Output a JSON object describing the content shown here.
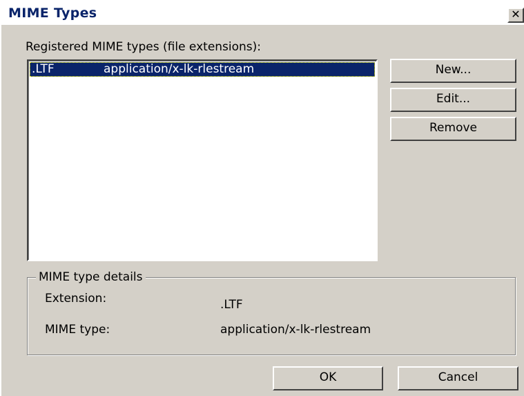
{
  "window": {
    "title": "MIME Types",
    "close_glyph": "✕"
  },
  "list": {
    "label": "Registered MIME types (file extensions):",
    "items": [
      {
        "extension": ".LTF",
        "mime": "application/x-lk-rlestream",
        "selected": true
      }
    ]
  },
  "buttons": {
    "new": "New...",
    "edit": "Edit...",
    "remove": "Remove",
    "ok": "OK",
    "cancel": "Cancel"
  },
  "details": {
    "group_title": "MIME type details",
    "extension_label": "Extension:",
    "extension_value": ".LTF",
    "mime_label": "MIME type:",
    "mime_value": "application/x-lk-rlestream"
  },
  "colors": {
    "dialog_bg": "#d4d0c8",
    "selection": "#0a246a",
    "title_text": "#0a246a"
  }
}
